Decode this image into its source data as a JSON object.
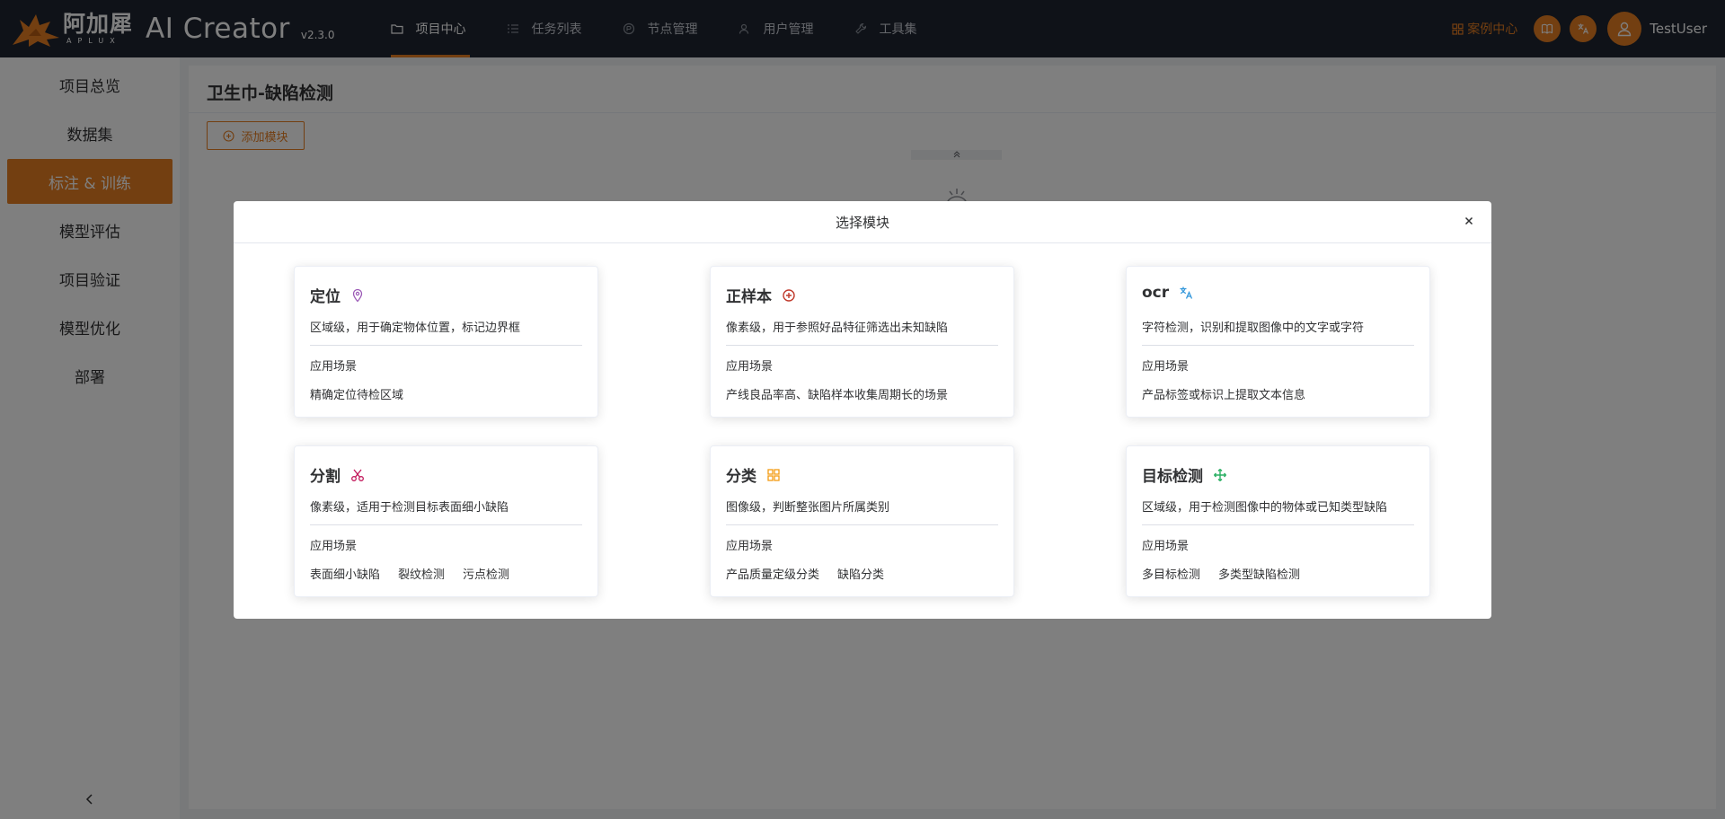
{
  "header": {
    "brand_cn": "阿加犀",
    "brand_en": "APLUX",
    "app_name": "AI Creator",
    "version": "v2.3.0",
    "nav": [
      {
        "label": "项目中心",
        "icon": "folder-icon",
        "active": true
      },
      {
        "label": "任务列表",
        "icon": "list-icon",
        "active": false
      },
      {
        "label": "节点管理",
        "icon": "node-icon",
        "active": false
      },
      {
        "label": "用户管理",
        "icon": "users-icon",
        "active": false
      },
      {
        "label": "工具集",
        "icon": "wrench-icon",
        "active": false
      }
    ],
    "case_center": "案例中心",
    "username": "TestUser"
  },
  "sidebar": {
    "items": [
      {
        "label": "项目总览"
      },
      {
        "label": "数据集"
      },
      {
        "label": "标注 & 训练",
        "active": true
      },
      {
        "label": "模型评估"
      },
      {
        "label": "项目验证"
      },
      {
        "label": "模型优化"
      },
      {
        "label": "部署"
      }
    ]
  },
  "page": {
    "title": "卫生巾-缺陷检测",
    "add_module_label": "添加模块"
  },
  "modal": {
    "title": "选择模块",
    "scenario_label": "应用场景",
    "cards": [
      {
        "title": "定位",
        "icon": "location-pin-icon",
        "icon_color": "#9b59b6",
        "desc": "区域级，用于确定物体位置，标记边界框",
        "scenario_label": "应用场景",
        "tags": [
          "精确定位待检区域"
        ]
      },
      {
        "title": "正样本",
        "icon": "plus-circle-icon",
        "icon_color": "#c0392b",
        "desc": "像素级，用于参照好品特征筛选出未知缺陷",
        "scenario_label": "应用场景",
        "tags": [
          "产线良品率高、缺陷样本收集周期长的场景"
        ]
      },
      {
        "title": "ocr",
        "icon": "translate-icon",
        "icon_color": "#3498db",
        "desc": "字符检测，识别和提取图像中的文字或字符",
        "scenario_label": "应用场景",
        "tags": [
          "产品标签或标识上提取文本信息"
        ]
      },
      {
        "title": "分割",
        "icon": "scissors-icon",
        "icon_color": "#c2185b",
        "desc": "像素级，适用于检测目标表面细小缺陷",
        "scenario_label": "应用场景",
        "tags": [
          "表面细小缺陷",
          "裂纹检测",
          "污点检测"
        ]
      },
      {
        "title": "分类",
        "icon": "grid-icon",
        "icon_color": "#f39c12",
        "desc": "图像级，判断整张图片所属类别",
        "scenario_label": "应用场景",
        "tags": [
          "产品质量定级分类",
          "缺陷分类"
        ]
      },
      {
        "title": "目标检测",
        "icon": "move-arrows-icon",
        "icon_color": "#27ae60",
        "desc": "区域级，用于检测图像中的物体或已知类型缺陷",
        "scenario_label": "应用场景",
        "tags": [
          "多目标检测",
          "多类型缺陷检测"
        ]
      }
    ]
  },
  "colors": {
    "accent": "#e67e22",
    "header_bg": "#1e2430"
  }
}
